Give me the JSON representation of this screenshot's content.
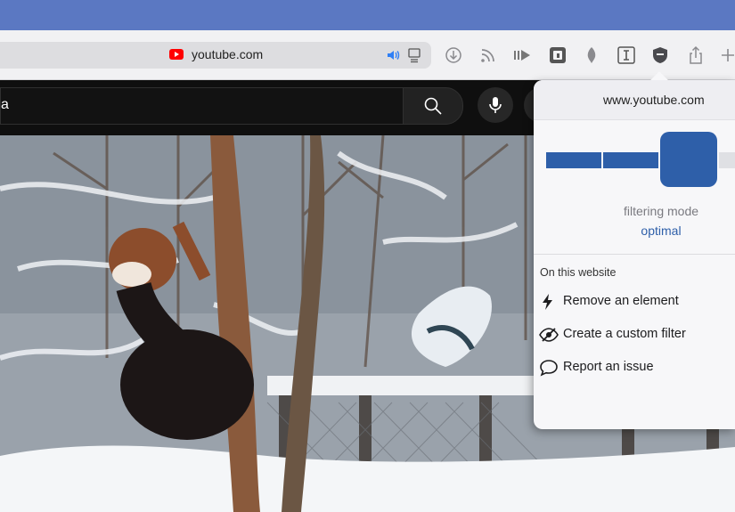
{
  "browser": {
    "url": "youtube.com",
    "toolbar_icons": [
      "download-icon",
      "rss-icon",
      "forward-icon",
      "app-icon",
      "bird-icon",
      "reader-text-icon",
      "shield-icon",
      "share-icon",
      "new-tab-icon"
    ]
  },
  "youtube": {
    "search_value": "a"
  },
  "popup": {
    "domain": "www.youtube.com",
    "mode_label": "filtering mode",
    "mode_value": "optimal",
    "section_label": "On this website",
    "items": [
      {
        "label": "Remove an element",
        "icon": "lightning-icon"
      },
      {
        "label": "Create a custom filter",
        "icon": "eye-slash-icon"
      },
      {
        "label": "Report an issue",
        "icon": "speech-bubble-icon"
      }
    ],
    "accent": "#2e5fa9"
  }
}
